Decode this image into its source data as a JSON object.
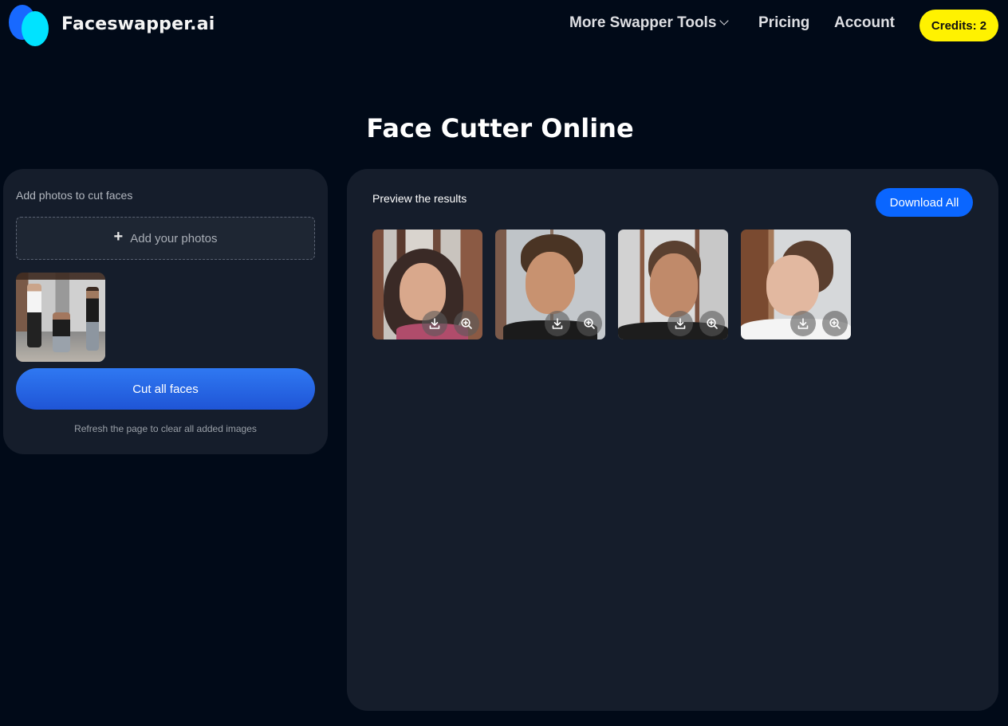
{
  "header": {
    "logo_text": "Faceswapper.ai",
    "nav": {
      "tools_label": "More Swapper Tools",
      "pricing_label": "Pricing",
      "account_label": "Account"
    },
    "credits_label": "Credits: 2"
  },
  "page": {
    "title": "Face Cutter Online"
  },
  "upload_panel": {
    "label": "Add photos to cut faces",
    "add_button_icon": "+",
    "add_button_label": "Add your photos",
    "uploaded_images": [
      {
        "alt": "group photo of three young men"
      }
    ],
    "cut_button_label": "Cut all faces",
    "refresh_note": "Refresh the page to clear all added images"
  },
  "results_panel": {
    "label": "Preview the results",
    "download_all_label": "Download All",
    "results": [
      {
        "alt": "cropped face 1",
        "download_icon": "download-icon",
        "zoom_icon": "zoom-in-icon"
      },
      {
        "alt": "cropped face 2",
        "download_icon": "download-icon",
        "zoom_icon": "zoom-in-icon"
      },
      {
        "alt": "cropped face 3",
        "download_icon": "download-icon",
        "zoom_icon": "zoom-in-icon"
      },
      {
        "alt": "cropped face 4",
        "download_icon": "download-icon",
        "zoom_icon": "zoom-in-icon"
      }
    ]
  },
  "colors": {
    "background": "#010a18",
    "panel": "#151d2b",
    "accent_blue": "#0a66ff",
    "credits_yellow": "#fff200",
    "logo_blue": "#1869ff",
    "logo_cyan": "#00e3ff"
  }
}
